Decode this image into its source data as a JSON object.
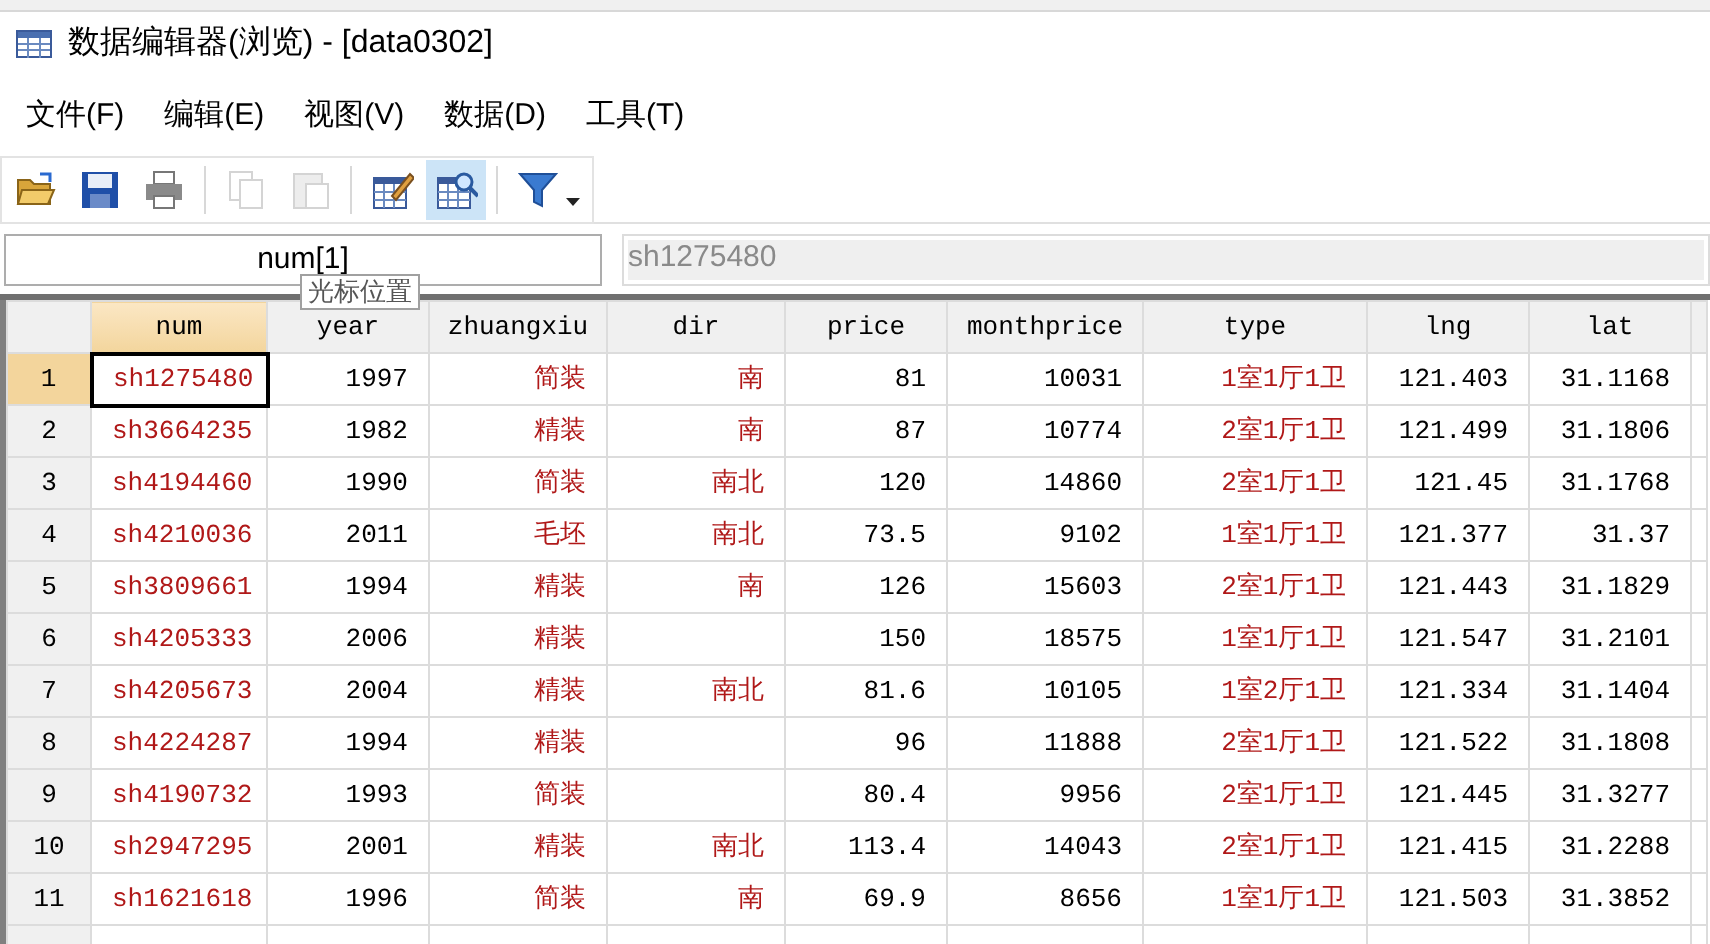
{
  "window": {
    "title": "数据编辑器(浏览) - [data0302]"
  },
  "menu": [
    "文件(F)",
    "编辑(E)",
    "视图(V)",
    "数据(D)",
    "工具(T)"
  ],
  "toolbar": [
    {
      "kind": "open",
      "disabled": false,
      "selected": false
    },
    {
      "kind": "save",
      "disabled": false,
      "selected": false
    },
    {
      "kind": "print",
      "disabled": false,
      "selected": false
    },
    {
      "kind": "separator"
    },
    {
      "kind": "copy",
      "disabled": true,
      "selected": false
    },
    {
      "kind": "paste",
      "disabled": true,
      "selected": false
    },
    {
      "kind": "separator"
    },
    {
      "kind": "edit",
      "disabled": false,
      "selected": false
    },
    {
      "kind": "browse",
      "disabled": false,
      "selected": true
    },
    {
      "kind": "separator"
    },
    {
      "kind": "filter",
      "disabled": false,
      "selected": false
    }
  ],
  "cell_name": {
    "value": "num[1]"
  },
  "cell_value": {
    "value": "sh1275480"
  },
  "tooltip": "光标位置",
  "table": {
    "columns": [
      {
        "label": "num",
        "kind": "string",
        "selected": true
      },
      {
        "label": "year",
        "kind": "number",
        "selected": false
      },
      {
        "label": "zhuangxiu",
        "kind": "string",
        "selected": false
      },
      {
        "label": "dir",
        "kind": "string",
        "selected": false
      },
      {
        "label": "price",
        "kind": "number",
        "selected": false
      },
      {
        "label": "monthprice",
        "kind": "number",
        "selected": false
      },
      {
        "label": "type",
        "kind": "string",
        "selected": false
      },
      {
        "label": "lng",
        "kind": "number",
        "selected": false
      },
      {
        "label": "lat",
        "kind": "number",
        "selected": false
      }
    ],
    "rows": [
      {
        "label": "1",
        "selected": true,
        "cells": [
          "sh1275480",
          "1997",
          "简装",
          "南",
          "81",
          "10031",
          "1室1厅1卫",
          "121.403",
          "31.1168"
        ]
      },
      {
        "label": "2",
        "selected": false,
        "cells": [
          "sh3664235",
          "1982",
          "精装",
          "南",
          "87",
          "10774",
          "2室1厅1卫",
          "121.499",
          "31.1806"
        ]
      },
      {
        "label": "3",
        "selected": false,
        "cells": [
          "sh4194460",
          "1990",
          "简装",
          "南北",
          "120",
          "14860",
          "2室1厅1卫",
          "121.45",
          "31.1768"
        ]
      },
      {
        "label": "4",
        "selected": false,
        "cells": [
          "sh4210036",
          "2011",
          "毛坯",
          "南北",
          "73.5",
          "9102",
          "1室1厅1卫",
          "121.377",
          "31.37"
        ]
      },
      {
        "label": "5",
        "selected": false,
        "cells": [
          "sh3809661",
          "1994",
          "精装",
          "南",
          "126",
          "15603",
          "2室1厅1卫",
          "121.443",
          "31.1829"
        ]
      },
      {
        "label": "6",
        "selected": false,
        "cells": [
          "sh4205333",
          "2006",
          "精装",
          "",
          "150",
          "18575",
          "1室1厅1卫",
          "121.547",
          "31.2101"
        ]
      },
      {
        "label": "7",
        "selected": false,
        "cells": [
          "sh4205673",
          "2004",
          "精装",
          "南北",
          "81.6",
          "10105",
          "1室2厅1卫",
          "121.334",
          "31.1404"
        ]
      },
      {
        "label": "8",
        "selected": false,
        "cells": [
          "sh4224287",
          "1994",
          "精装",
          "",
          "96",
          "11888",
          "2室1厅1卫",
          "121.522",
          "31.1808"
        ]
      },
      {
        "label": "9",
        "selected": false,
        "cells": [
          "sh4190732",
          "1993",
          "简装",
          "",
          "80.4",
          "9956",
          "2室1厅1卫",
          "121.445",
          "31.3277"
        ]
      },
      {
        "label": "10",
        "selected": false,
        "cells": [
          "sh2947295",
          "2001",
          "精装",
          "南北",
          "113.4",
          "14043",
          "2室1厅1卫",
          "121.415",
          "31.2288"
        ]
      },
      {
        "label": "11",
        "selected": false,
        "cells": [
          "sh1621618",
          "1996",
          "简装",
          "南",
          "69.9",
          "8656",
          "1室1厅1卫",
          "121.503",
          "31.3852"
        ]
      }
    ]
  }
}
